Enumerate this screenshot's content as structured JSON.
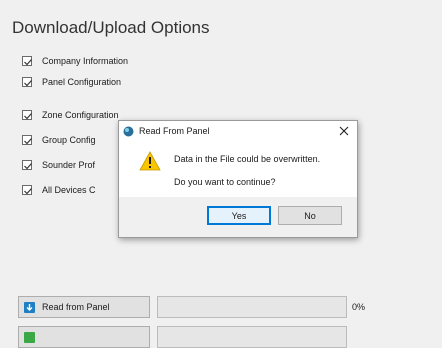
{
  "panel": {
    "title": "Download/Upload Options",
    "options": [
      {
        "label": "Company Information",
        "checked": true
      },
      {
        "label": "Panel Configuration",
        "checked": true
      },
      {
        "label": "Zone Configuration",
        "checked": true
      },
      {
        "label": "Group Config",
        "checked": true
      },
      {
        "label": "Sounder Prof",
        "checked": true
      },
      {
        "label": "All Devices C",
        "checked": true
      }
    ]
  },
  "actions": {
    "read_from_panel": {
      "label": "Read from Panel",
      "icon": "read-panel-icon",
      "progress_percent": 0,
      "progress_text": "0%"
    },
    "write_to_panel": {
      "icon": "write-panel-icon",
      "progress_percent": 0
    }
  },
  "dialog": {
    "title": "Read From Panel",
    "message_line1": "Data in the File could be overwritten.",
    "message_line2": "Do you want to continue?",
    "yes_label": "Yes",
    "no_label": "No",
    "icon": "warning-icon",
    "close_icon": "close-icon"
  },
  "colors": {
    "accent": "#0078d7",
    "warning": "#f7c600",
    "progress": "#06b025"
  }
}
